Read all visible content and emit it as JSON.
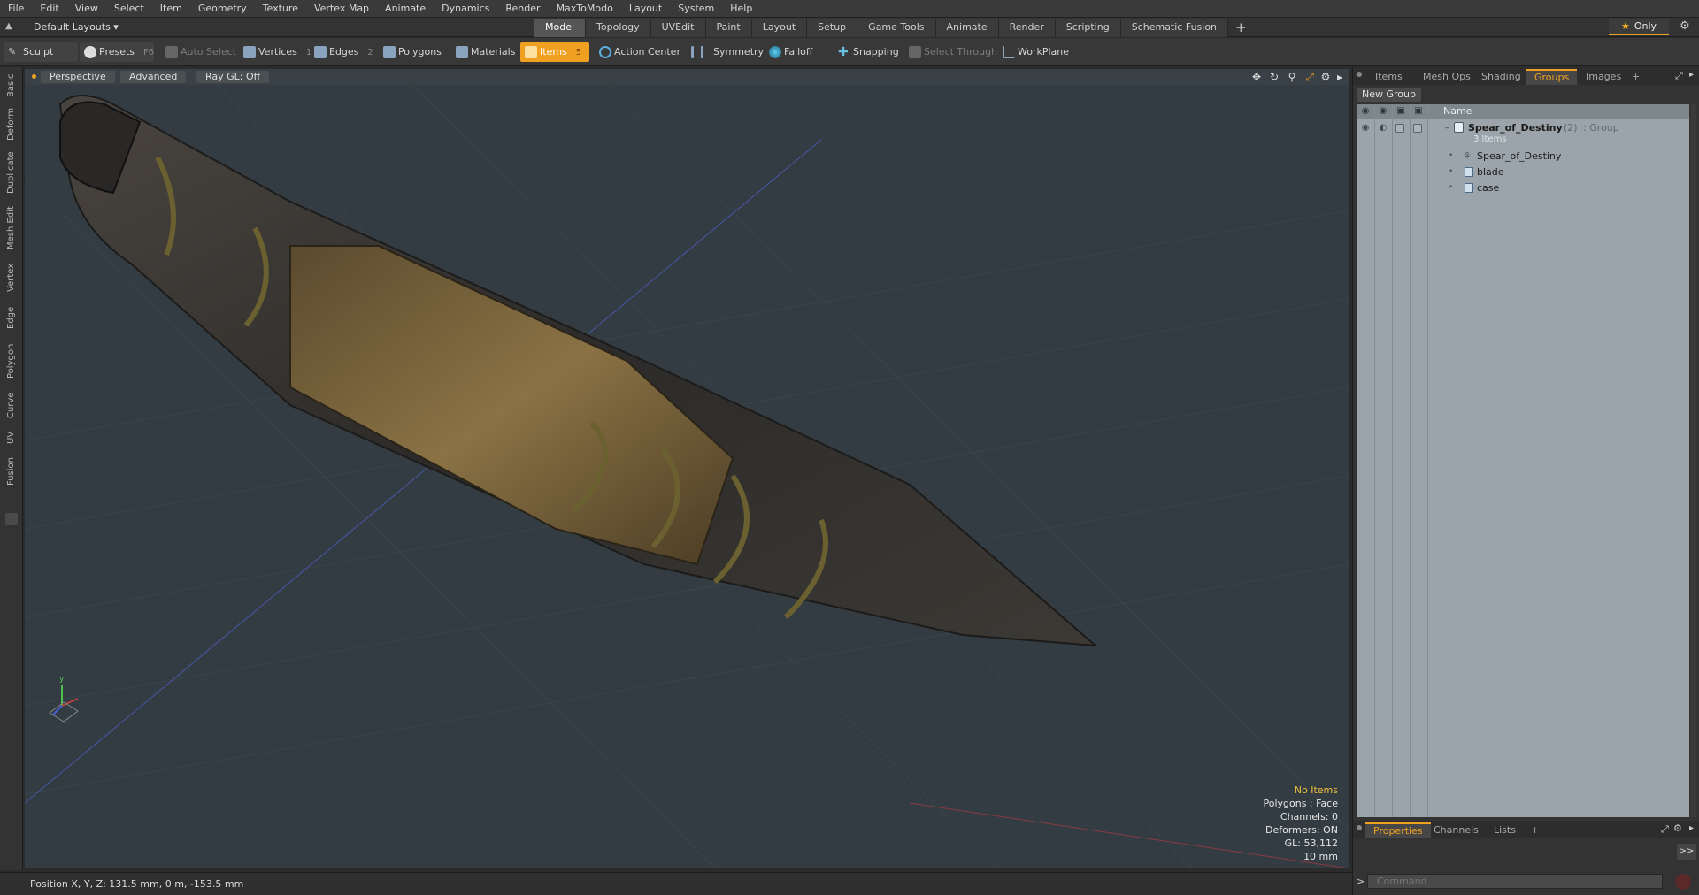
{
  "menu": [
    "File",
    "Edit",
    "View",
    "Select",
    "Item",
    "Geometry",
    "Texture",
    "Vertex Map",
    "Animate",
    "Dynamics",
    "Render",
    "MaxToModo",
    "Layout",
    "System",
    "Help"
  ],
  "layout_select": "Default Layouts ▾",
  "tabs": [
    "Model",
    "Topology",
    "UVEdit",
    "Paint",
    "Layout",
    "Setup",
    "Game Tools",
    "Animate",
    "Render",
    "Scripting",
    "Schematic Fusion"
  ],
  "tab_plus": "+",
  "active_tab": "Model",
  "only_label": "Only",
  "toolbar": {
    "sculpt": "Sculpt",
    "presets": "Presets",
    "presets_key": "F6",
    "auto_select": "Auto Select",
    "vertices": "Vertices",
    "vertices_num": "1",
    "edges": "Edges",
    "edges_num": "2",
    "polygons": "Polygons",
    "materials": "Materials",
    "items": "Items",
    "items_num": "5",
    "action_center": "Action Center",
    "symmetry": "Symmetry",
    "falloff": "Falloff",
    "snapping": "Snapping",
    "select_through": "Select Through",
    "workplane": "WorkPlane"
  },
  "left_tabs": [
    "Basic",
    "Deform",
    "Duplicate",
    "Mesh Edit",
    "Vertex",
    "Edge",
    "Polygon",
    "Curve",
    "UV",
    "Fusion"
  ],
  "viewport": {
    "view_mode": "Perspective",
    "shading": "Advanced",
    "raygl": "Ray GL: Off",
    "info": {
      "no_items": "No Items",
      "polygons": "Polygons : Face",
      "channels": "Channels: 0",
      "deformers": "Deformers: ON",
      "gl": "GL: 53,112",
      "scale": "10 mm"
    }
  },
  "status": {
    "position": "Position X, Y, Z:   131.5 mm, 0 m, -153.5 mm"
  },
  "right_panel": {
    "tabs": [
      "Items",
      "Mesh Ops",
      "Shading",
      "Groups",
      "Images"
    ],
    "active_tab": "Groups",
    "new_group": "New Group",
    "col_name": "Name",
    "group": {
      "name": "Spear_of_Destiny",
      "count": "(2)",
      "type": ": Group",
      "sub": "3 Items",
      "children": [
        "Spear_of_Destiny",
        "blade",
        "case"
      ]
    },
    "bottom_tabs": [
      "Properties",
      "Channels",
      "Lists"
    ],
    "command_placeholder": "Command",
    "expand": ">>"
  },
  "colors": {
    "accent": "#f0a020",
    "viewport_bg": "#323c42",
    "list_bg": "#9aa4aa"
  }
}
